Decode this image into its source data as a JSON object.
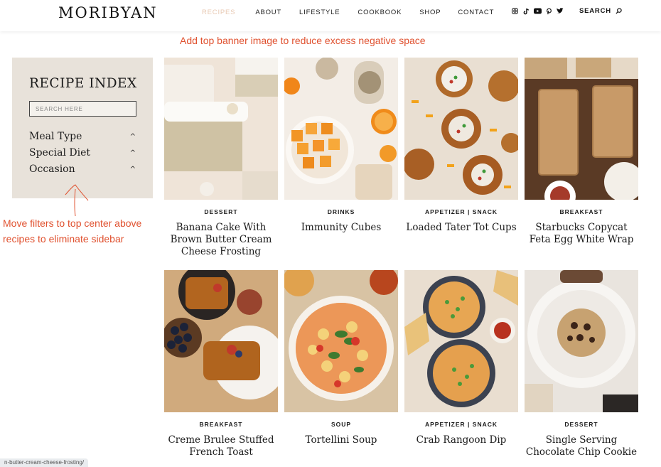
{
  "header": {
    "logo": "MORIBYAN",
    "nav": [
      {
        "label": "RECIPES",
        "active": true
      },
      {
        "label": "ABOUT",
        "active": false
      },
      {
        "label": "LIFESTYLE",
        "active": false
      },
      {
        "label": "COOKBOOK",
        "active": false
      },
      {
        "label": "SHOP",
        "active": false
      },
      {
        "label": "CONTACT",
        "active": false
      }
    ],
    "social_icons": [
      "instagram-icon",
      "tiktok-icon",
      "youtube-icon",
      "pinterest-icon",
      "twitter-icon"
    ],
    "search_label": "SEARCH"
  },
  "annotations": {
    "top": "Add top banner image to reduce excess negative space",
    "left": "Move filters to top center above recipes to eliminate sidebar",
    "color": "#e0512f"
  },
  "sidebar": {
    "title": "RECIPE INDEX",
    "search_placeholder": "SEARCH HERE",
    "filters": [
      "Meal Type",
      "Special Diet",
      "Occasion"
    ]
  },
  "recipes": [
    {
      "category": "DESSERT",
      "title": "Banana Cake With Brown Butter Cream Cheese Frosting"
    },
    {
      "category": "DRINKS",
      "title": "Immunity Cubes"
    },
    {
      "category": "APPETIZER | SNACK",
      "title": "Loaded Tater Tot Cups"
    },
    {
      "category": "BREAKFAST",
      "title": "Starbucks Copycat Feta Egg White Wrap"
    },
    {
      "category": "BREAKFAST",
      "title": "Creme Brulee Stuffed French Toast"
    },
    {
      "category": "SOUP",
      "title": "Tortellini Soup"
    },
    {
      "category": "APPETIZER | SNACK",
      "title": "Crab Rangoon Dip"
    },
    {
      "category": "DESSERT",
      "title": "Single Serving Chocolate Chip Cookie"
    }
  ],
  "status_url": "n-butter-cream-cheese-frosting/"
}
